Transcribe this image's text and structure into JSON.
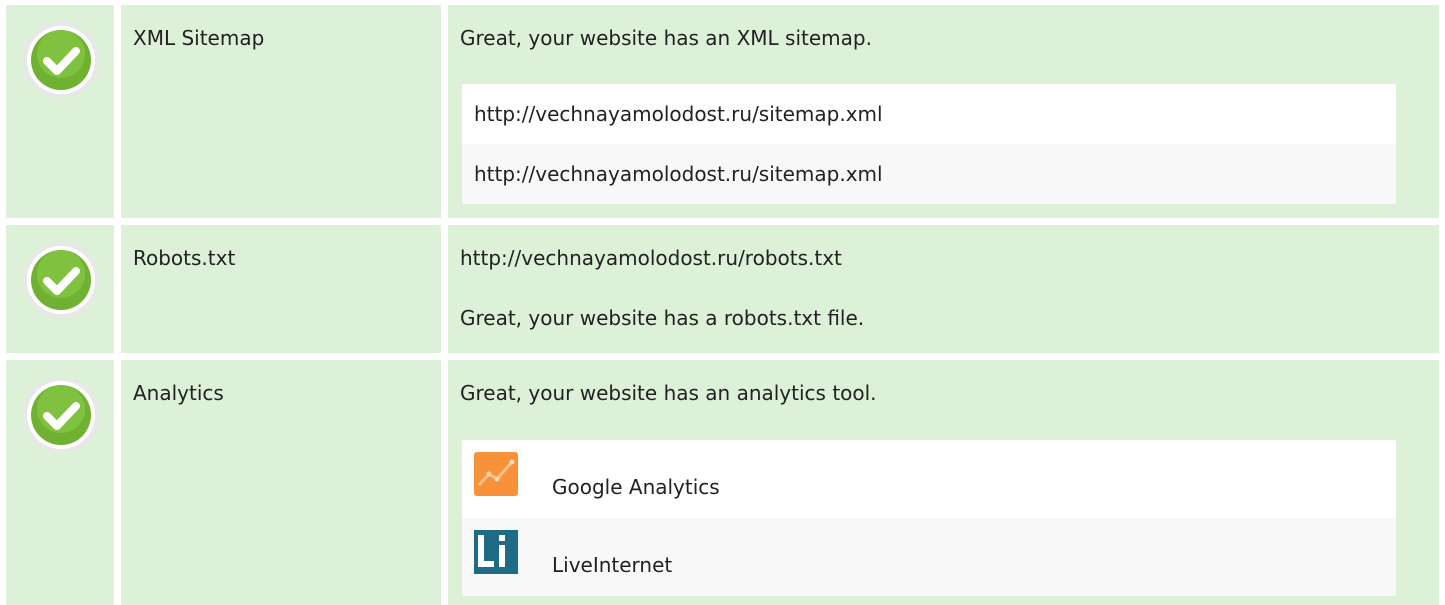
{
  "accent": {
    "check_green": "#7cbd3c",
    "cell_bg": "#ddf0d8"
  },
  "rows": [
    {
      "status_icon": "check-icon",
      "name": "XML Sitemap",
      "message": "Great, your website has an XML sitemap.",
      "items": [
        "http://vechnayamolodost.ru/sitemap.xml",
        "http://vechnayamolodost.ru/sitemap.xml"
      ]
    },
    {
      "status_icon": "check-icon",
      "name": "Robots.txt",
      "url": "http://vechnayamolodost.ru/robots.txt",
      "message": "Great, your website has a robots.txt file."
    },
    {
      "status_icon": "check-icon",
      "name": "Analytics",
      "message": "Great, your website has an analytics tool.",
      "tools": [
        {
          "icon": "google-analytics-icon",
          "label": "Google Analytics"
        },
        {
          "icon": "liveinternet-icon",
          "label": "LiveInternet"
        }
      ]
    }
  ]
}
